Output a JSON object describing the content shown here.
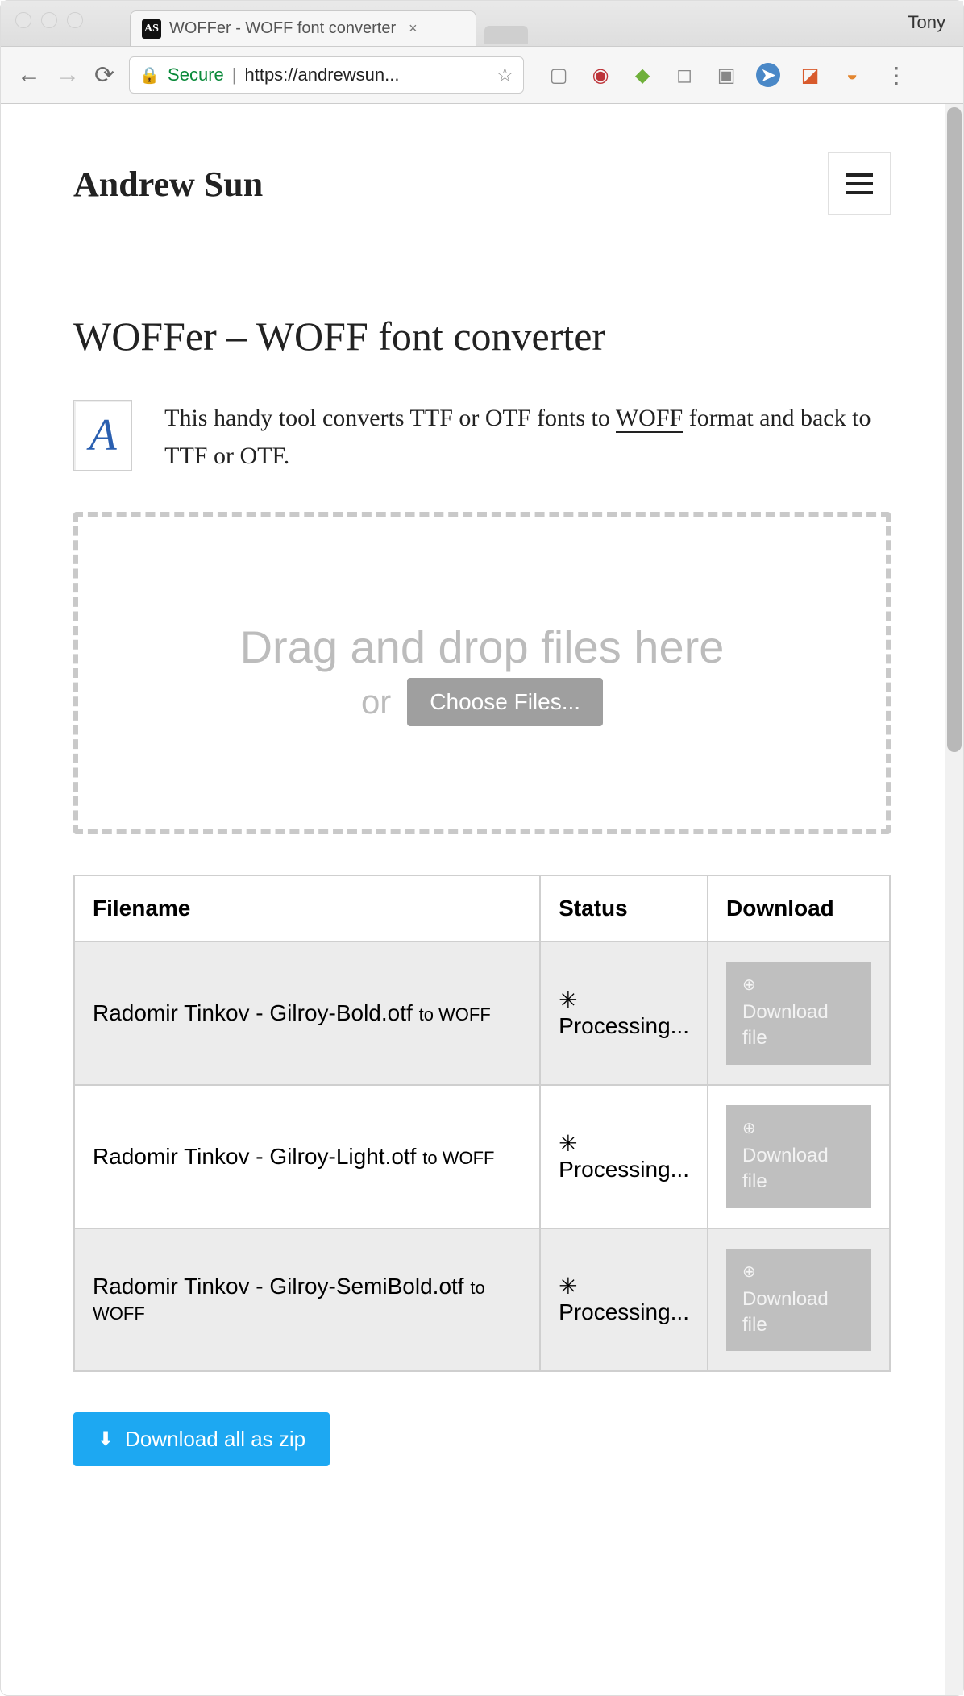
{
  "browser": {
    "profile_name": "Tony",
    "tab_title": "WOFFer - WOFF font converter",
    "favicon_text": "AS",
    "secure_label": "Secure",
    "url_display": "https://andrewsun..."
  },
  "header": {
    "brand": "Andrew Sun"
  },
  "page": {
    "title": "WOFFer – WOFF font converter",
    "intro_prefix": "This handy tool converts TTF or OTF fonts to ",
    "intro_link": "WOFF",
    "intro_suffix": " format and back to TTF or OTF.",
    "font_thumb_glyph": "A"
  },
  "dropzone": {
    "headline": "Drag and drop files here",
    "or_label": "or",
    "choose_label": "Choose Files..."
  },
  "table": {
    "headers": {
      "filename": "Filename",
      "status": "Status",
      "download": "Download"
    },
    "to_label": "to",
    "target_format": "WOFF",
    "processing_label": "Processing...",
    "download_label": "Download file",
    "rows": [
      {
        "filename": "Radomir Tinkov - Gilroy-Bold.otf"
      },
      {
        "filename": "Radomir Tinkov - Gilroy-Light.otf"
      },
      {
        "filename": "Radomir Tinkov - Gilroy-SemiBold.otf"
      }
    ]
  },
  "zip_button_label": "Download all as zip"
}
